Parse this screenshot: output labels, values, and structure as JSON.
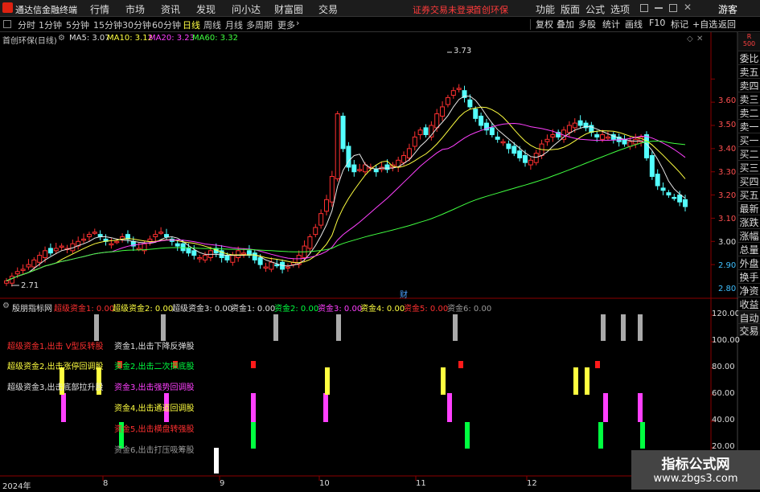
{
  "menubar": {
    "app_name": "通达信金融终端",
    "items": [
      "行情",
      "市场",
      "资讯",
      "发现",
      "问小达",
      "财富圈",
      "交易"
    ],
    "notice": "证券交易未登录",
    "stock_name": "首创环保",
    "right_items": [
      "功能",
      "版面",
      "公式",
      "选项"
    ],
    "user": "游客"
  },
  "tabs": {
    "periods": [
      "分时",
      "1分钟",
      "5分钟",
      "15分钟",
      "30分钟",
      "60分钟",
      "日线",
      "周线",
      "月线",
      "多周期",
      "更多"
    ],
    "active": "日线",
    "right": [
      "复权",
      "叠加",
      "多股",
      "统计",
      "画线",
      "F10",
      "标记",
      "+自选",
      "返回"
    ]
  },
  "price_panel": {
    "title": "首创环保(日线)",
    "ma5": "MA5: 3.07",
    "ma10": "MA10: 3.12",
    "ma20": "MA20: 3.23",
    "ma60": "MA60: 3.32",
    "high_label": "3.73",
    "low_label": "2.71",
    "cai_label": "财",
    "price_ticks": [
      "3.60",
      "3.50",
      "3.40",
      "3.30",
      "3.20",
      "3.10",
      "3.00",
      "2.90",
      "2.80"
    ]
  },
  "indicator": {
    "name": "殷朋指标网",
    "legend": [
      {
        "text": "超级资金1: 0.00",
        "color": "#ff3030"
      },
      {
        "text": "超级资金2: 0.00",
        "color": "#ffff40"
      },
      {
        "text": "超级资金3: 0.00",
        "color": "#e0e0e0"
      },
      {
        "text": "资金1: 0.00",
        "color": "#e0e0e0"
      },
      {
        "text": "资金2: 0.00",
        "color": "#00ff40"
      },
      {
        "text": "资金3: 0.00",
        "color": "#ff40ff"
      },
      {
        "text": "资金4: 0.00",
        "color": "#ffff40"
      },
      {
        "text": "资金5: 0.00",
        "color": "#ff3030"
      },
      {
        "text": "资金6: 0.00",
        "color": "#9a9a9a"
      }
    ],
    "labels": [
      {
        "text": "超级资金1,出击 V型反转股",
        "color": "#ff3030"
      },
      {
        "text": "资金1,出击下降反弹股",
        "color": "#e0e0e0"
      },
      {
        "text": "超级资金2,出击涨停回调股",
        "color": "#ffff40"
      },
      {
        "text": "资金2,出击二次探底股",
        "color": "#00ff40"
      },
      {
        "text": "超级资金3,出击底部拉升股",
        "color": "#e0e0e0"
      },
      {
        "text": "资金3,出击强势回调股",
        "color": "#ff40ff"
      },
      {
        "text": "资金4,出击通道回调股",
        "color": "#ffff40"
      },
      {
        "text": "资金5,出击横盘转强股",
        "color": "#ff3030"
      },
      {
        "text": "资金6,出击打压吸筹股",
        "color": "#9a9a9a"
      }
    ],
    "ticks": [
      "120.00",
      "100.00",
      "80.00",
      "60.00",
      "40.00",
      "20.00"
    ]
  },
  "xaxis": [
    "2024年",
    "8",
    "9",
    "10",
    "11",
    "12"
  ],
  "sidebar": {
    "top": "R\n500",
    "items": [
      "委比",
      "卖五",
      "卖四",
      "卖三",
      "卖二",
      "卖一",
      "买一",
      "买二",
      "买三",
      "买四",
      "买五",
      "最新",
      "涨跌",
      "涨幅",
      "总量",
      "外盘",
      "换手",
      "净资",
      "收益"
    ],
    "bottom": [
      "自动",
      "交易"
    ]
  },
  "watermark": {
    "line1": "指标公式网",
    "line2": "www.zbgs3.com"
  },
  "chart_data": [
    {
      "type": "candlestick",
      "title": "首创环保(日线)",
      "y_ticks": [
        3.6,
        3.5,
        3.4,
        3.3,
        3.2,
        3.1,
        3.0,
        2.9,
        2.8
      ],
      "ylim": [
        2.7,
        3.75
      ],
      "ma": {
        "MA5": 3.07,
        "MA10": 3.12,
        "MA20": 3.23,
        "MA60": 3.32
      },
      "high": 3.73,
      "low": 2.71,
      "close": [
        2.73,
        2.75,
        2.77,
        2.78,
        2.8,
        2.82,
        2.84,
        2.86,
        2.85,
        2.87,
        2.88,
        2.87,
        2.89,
        2.9,
        2.91,
        2.93,
        2.94,
        2.92,
        2.9,
        2.89,
        2.9,
        2.92,
        2.91,
        2.88,
        2.87,
        2.89,
        2.91,
        2.93,
        2.94,
        2.92,
        2.9,
        2.88,
        2.86,
        2.85,
        2.84,
        2.83,
        2.84,
        2.86,
        2.85,
        2.83,
        2.82,
        2.84,
        2.86,
        2.85,
        2.84,
        2.82,
        2.8,
        2.79,
        2.81,
        2.8,
        2.78,
        2.79,
        2.81,
        2.84,
        2.88,
        2.92,
        2.96,
        3.02,
        3.08,
        3.18,
        3.45,
        3.3,
        3.22,
        3.2,
        3.21,
        3.23,
        3.22,
        3.2,
        3.22,
        3.21,
        3.23,
        3.25,
        3.27,
        3.3,
        3.35,
        3.38,
        3.36,
        3.4,
        3.45,
        3.48,
        3.52,
        3.55,
        3.56,
        3.52,
        3.48,
        3.43,
        3.4,
        3.38,
        3.36,
        3.34,
        3.33,
        3.3,
        3.28,
        3.26,
        3.24,
        3.25,
        3.28,
        3.32,
        3.34,
        3.36,
        3.35,
        3.38,
        3.4,
        3.41,
        3.4,
        3.39,
        3.37,
        3.35,
        3.36,
        3.35,
        3.34,
        3.33,
        3.32,
        3.33,
        3.34,
        3.35,
        3.26,
        3.18,
        3.14,
        3.12,
        3.1,
        3.09,
        3.07,
        3.05
      ]
    },
    {
      "type": "bar",
      "title": "殷朋指标网",
      "y_ticks": [
        120,
        100,
        80,
        60,
        40,
        20
      ],
      "ylim": [
        0,
        125
      ],
      "series": [
        {
          "name": "资金6",
          "bars": [
            [
              148,
              40
            ],
            [
              312,
              40
            ],
            [
              578,
              40
            ],
            [
              744,
              40
            ],
            [
              796,
              40
            ]
          ]
        },
        {
          "name": "资金3",
          "bars": [
            [
              76,
              60
            ],
            [
              204,
              60
            ],
            [
              312,
              60
            ],
            [
              402,
              60
            ],
            [
              556,
              60
            ],
            [
              750,
              60
            ],
            [
              793,
              60
            ]
          ]
        },
        {
          "name": "资金4",
          "bars": [
            [
              74,
              80
            ],
            [
              120,
              80
            ],
            [
              404,
              80
            ],
            [
              548,
              80
            ],
            [
              713,
              80
            ],
            [
              727,
              80
            ]
          ]
        },
        {
          "name": "超级资金1",
          "bars": [
            [
              146,
              100
            ],
            [
              215,
              100
            ],
            [
              312,
              100
            ],
            [
              570,
              100
            ],
            [
              740,
              100
            ]
          ]
        },
        {
          "name": "资金1",
          "bars": [
            [
              117,
              120
            ],
            [
              200,
              120
            ],
            [
              340,
              120
            ],
            [
              418,
              120
            ],
            [
              563,
              120
            ],
            [
              747,
              120
            ],
            [
              772,
              120
            ],
            [
              793,
              120
            ]
          ]
        },
        {
          "name": "超级资金3",
          "bars": [
            [
              266,
              20
            ]
          ]
        }
      ]
    }
  ]
}
